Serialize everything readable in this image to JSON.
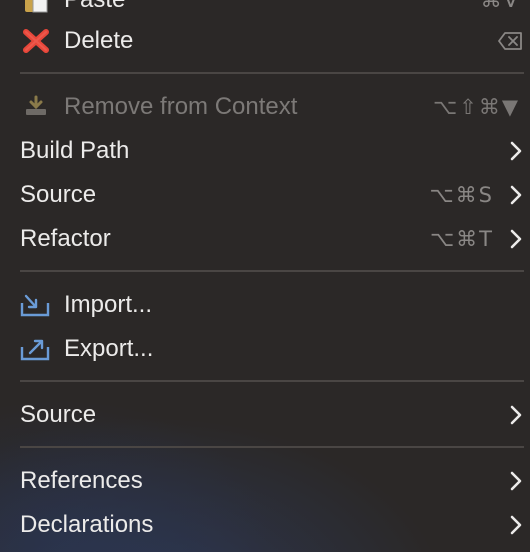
{
  "menu": {
    "paste": {
      "label": "Paste",
      "shortcut": "⌘V",
      "icon": "clipboard-icon"
    },
    "delete": {
      "label": "Delete",
      "shortcut_icon": "delete-key-icon",
      "icon": "red-x-icon"
    },
    "remove_from_context": {
      "label": "Remove from Context",
      "shortcut": "⌥⇧⌘▼",
      "icon": "remove-context-icon",
      "disabled": true
    },
    "build_path": {
      "label": "Build Path",
      "submenu": true
    },
    "source_1": {
      "label": "Source",
      "shortcut": "⌥⌘S",
      "submenu": true
    },
    "refactor": {
      "label": "Refactor",
      "shortcut": "⌥⌘T",
      "submenu": true
    },
    "import": {
      "label": "Import...",
      "icon": "import-icon"
    },
    "export": {
      "label": "Export...",
      "icon": "export-icon"
    },
    "source_2": {
      "label": "Source",
      "submenu": true
    },
    "references": {
      "label": "References",
      "submenu": true
    },
    "declarations": {
      "label": "Declarations",
      "submenu": true
    }
  },
  "colors": {
    "background": "#2b2827",
    "text": "#ecebea",
    "disabled_text": "#7c7977",
    "shortcut_text": "#8a8785",
    "separator": "#4a4644",
    "delete_red": "#e8473a",
    "icon_blue": "#6a9bd6"
  }
}
